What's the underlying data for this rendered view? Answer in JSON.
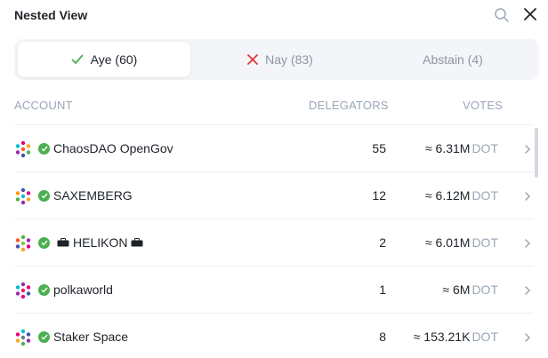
{
  "header": {
    "title": "Nested View"
  },
  "tabs": [
    {
      "label": "Aye (60)",
      "icon": "check-icon",
      "color": "#4caf50",
      "active": true
    },
    {
      "label": "Nay (83)",
      "icon": "cross-icon",
      "color": "#e53935",
      "active": false
    },
    {
      "label": "Abstain (4)",
      "icon": "",
      "active": false
    }
  ],
  "columns": {
    "account": "ACCOUNT",
    "delegators": "DELEGATORS",
    "votes": "VOTES"
  },
  "rows": [
    {
      "name": "ChaosDAO OpenGov",
      "delegators": "55",
      "votes": "≈ 6.31M",
      "unit": "DOT"
    },
    {
      "name": "SAXEMBERG",
      "delegators": "12",
      "votes": "≈ 6.12M",
      "unit": "DOT"
    },
    {
      "name": "HELIKON",
      "delegators": "2",
      "votes": "≈ 6.01M",
      "unit": "DOT"
    },
    {
      "name": "polkaworld",
      "delegators": "1",
      "votes": "≈ 6M",
      "unit": "DOT"
    },
    {
      "name": "Staker Space",
      "delegators": "8",
      "votes": "≈ 153.21K",
      "unit": "DOT"
    }
  ],
  "colors": {
    "verified": "#4caf50",
    "muted": "#9aa6b6"
  }
}
